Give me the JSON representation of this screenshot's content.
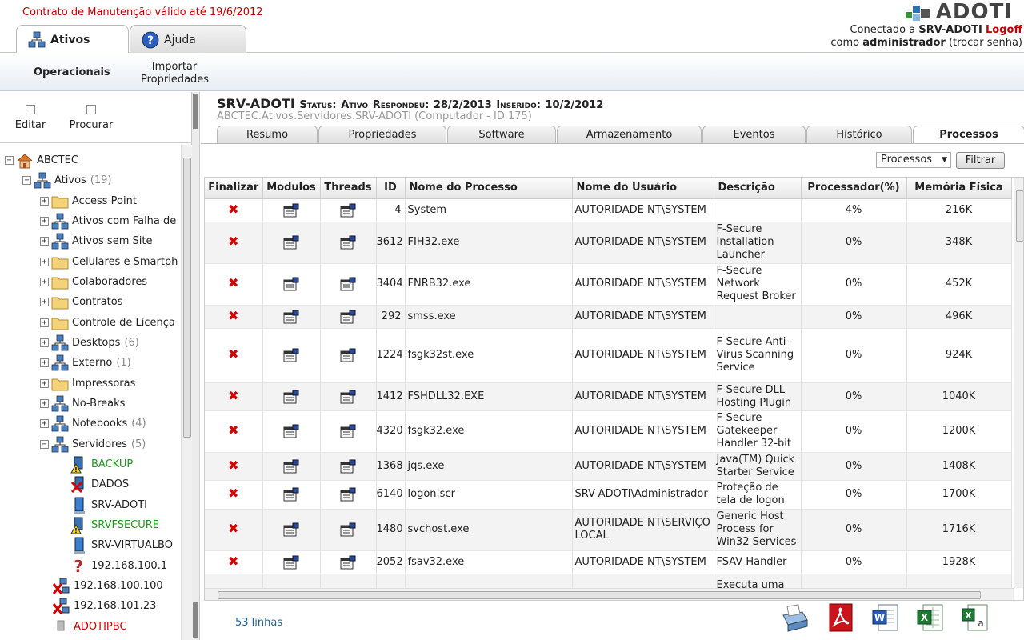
{
  "header": {
    "contract": "Contrato de Manutenção válido até 19/6/2012",
    "logo_text": "ADOTI",
    "conn_prefix": "Conectado a",
    "server": "SRV-ADOTI",
    "logoff": "Logoff",
    "as_prefix": "como",
    "user": "administrador",
    "change_pw": "(trocar senha)",
    "tabs": [
      {
        "label": "Ativos"
      },
      {
        "label": "Ajuda"
      }
    ]
  },
  "subbar": {
    "operacionais": "Operacionais",
    "importar_1": "Importar",
    "importar_2": "Propriedades"
  },
  "left": {
    "editar": "Editar",
    "procurar": "Procurar",
    "tree": [
      {
        "label": "ABCTEC",
        "count": ""
      },
      {
        "label": "Ativos",
        "count": "(19)"
      },
      {
        "label": "Access Point",
        "count": ""
      },
      {
        "label": "Ativos com Falha de",
        "count": ""
      },
      {
        "label": "Ativos sem Site",
        "count": ""
      },
      {
        "label": "Celulares e Smartph",
        "count": ""
      },
      {
        "label": "Colaboradores",
        "count": ""
      },
      {
        "label": "Contratos",
        "count": ""
      },
      {
        "label": "Controle de Licença",
        "count": ""
      },
      {
        "label": "Desktops",
        "count": "(6)"
      },
      {
        "label": "Externo",
        "count": "(1)"
      },
      {
        "label": "Impressoras",
        "count": ""
      },
      {
        "label": "No-Breaks",
        "count": ""
      },
      {
        "label": "Notebooks",
        "count": "(4)"
      },
      {
        "label": "Servidores",
        "count": "(5)"
      },
      {
        "label": "BACKUP",
        "count": ""
      },
      {
        "label": "DADOS",
        "count": ""
      },
      {
        "label": "SRV-ADOTI",
        "count": ""
      },
      {
        "label": "SRVFSECURE",
        "count": ""
      },
      {
        "label": "SRV-VIRTUALBO",
        "count": ""
      },
      {
        "label": "192.168.100.1",
        "count": ""
      },
      {
        "label": "192.168.100.100",
        "count": ""
      },
      {
        "label": "192.168.101.23",
        "count": ""
      },
      {
        "label": "ADOTIPBC",
        "count": ""
      }
    ]
  },
  "asset": {
    "name": "SRV-ADOTI",
    "status_label": "Status:",
    "status": "Ativo",
    "resp_label": "Respondeu:",
    "resp": "28/2/2013",
    "ins_label": "Inserido:",
    "ins": "10/2/2012",
    "path": "ABCTEC.Ativos.Servidores.SRV-ADOTI  (Computador - ID 175)"
  },
  "tabs": [
    "Resumo",
    "Propriedades",
    "Software",
    "Armazenamento",
    "Eventos",
    "Histórico",
    "Processos"
  ],
  "filter": {
    "select": "Processos",
    "button": "Filtrar"
  },
  "table": {
    "headers": [
      "Finalizar",
      "Modulos",
      "Threads",
      "ID",
      "Nome do Processo",
      "Nome do Usuário",
      "Descrição",
      "Processador(%)",
      "Memória Física"
    ],
    "rows": [
      {
        "id": "4",
        "name": "System",
        "user": "AUTORIDADE NT\\SYSTEM",
        "desc": "",
        "cpu": "4%",
        "mem": "216K"
      },
      {
        "id": "3612",
        "name": "FIH32.exe",
        "user": "AUTORIDADE NT\\SYSTEM",
        "desc": "F-Secure Installation Launcher",
        "cpu": "0%",
        "mem": "348K"
      },
      {
        "id": "3404",
        "name": "FNRB32.exe",
        "user": "AUTORIDADE NT\\SYSTEM",
        "desc": "F-Secure Network Request Broker",
        "cpu": "0%",
        "mem": "452K"
      },
      {
        "id": "292",
        "name": "smss.exe",
        "user": "AUTORIDADE NT\\SYSTEM",
        "desc": "",
        "cpu": "0%",
        "mem": "496K"
      },
      {
        "id": "1224",
        "name": "fsgk32st.exe",
        "user": "AUTORIDADE NT\\SYSTEM",
        "desc": "F-Secure Anti-Virus Scanning Service",
        "cpu": "0%",
        "mem": "924K"
      },
      {
        "id": "1412",
        "name": "FSHDLL32.EXE",
        "user": "AUTORIDADE NT\\SYSTEM",
        "desc": "F-Secure DLL Hosting Plugin",
        "cpu": "0%",
        "mem": "1040K"
      },
      {
        "id": "4320",
        "name": "fsgk32.exe",
        "user": "AUTORIDADE NT\\SYSTEM",
        "desc": "F-Secure Gatekeeper Handler 32-bit",
        "cpu": "0%",
        "mem": "1200K"
      },
      {
        "id": "1368",
        "name": "jqs.exe",
        "user": "AUTORIDADE NT\\SYSTEM",
        "desc": "Java(TM) Quick Starter Service",
        "cpu": "0%",
        "mem": "1408K"
      },
      {
        "id": "6140",
        "name": "logon.scr",
        "user": "SRV-ADOTI\\Administrador",
        "desc": "Proteção de tela de logon",
        "cpu": "0%",
        "mem": "1700K"
      },
      {
        "id": "1480",
        "name": "svchost.exe",
        "user": "AUTORIDADE NT\\SERVIÇO LOCAL",
        "desc": "Generic Host Process for Win32 Services",
        "cpu": "0%",
        "mem": "1716K"
      },
      {
        "id": "2052",
        "name": "fsav32.exe",
        "user": "AUTORIDADE NT\\SYSTEM",
        "desc": "FSAV Handler",
        "cpu": "0%",
        "mem": "1928K"
      },
      {
        "id": "",
        "name": "",
        "user": "",
        "desc": "Executa uma",
        "cpu": "",
        "mem": ""
      }
    ]
  },
  "footer": {
    "rows_count": "53 linhas"
  },
  "colors": {
    "accent_red": "#c00000",
    "green": "#1a9a1a"
  }
}
